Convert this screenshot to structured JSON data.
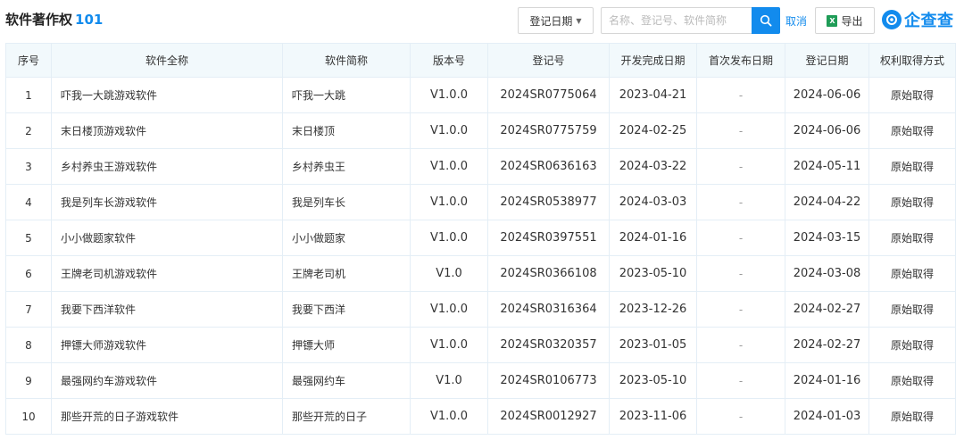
{
  "header": {
    "title": "软件著作权",
    "count": "101",
    "date_filter_label": "登记日期",
    "search_placeholder": "名称、登记号、软件简称",
    "cancel_label": "取消",
    "export_label": "导出",
    "logo_text": "企查查"
  },
  "colors": {
    "accent": "#128bed",
    "header_bg": "#f2f9fc",
    "border": "#e4eef6",
    "excel_green": "#1f9c57"
  },
  "icons": {
    "date_filter": "caret-down-icon",
    "search": "search-icon",
    "export": "excel-icon",
    "logo": "qcc-logo-icon"
  },
  "table": {
    "columns": [
      "序号",
      "软件全称",
      "软件简称",
      "版本号",
      "登记号",
      "开发完成日期",
      "首次发布日期",
      "登记日期",
      "权利取得方式"
    ],
    "rows": [
      [
        "1",
        "吓我一大跳游戏软件",
        "吓我一大跳",
        "V1.0.0",
        "2024SR0775064",
        "2023-04-21",
        "-",
        "2024-06-06",
        "原始取得"
      ],
      [
        "2",
        "末日楼顶游戏软件",
        "末日楼顶",
        "V1.0.0",
        "2024SR0775759",
        "2024-02-25",
        "-",
        "2024-06-06",
        "原始取得"
      ],
      [
        "3",
        "乡村养虫王游戏软件",
        "乡村养虫王",
        "V1.0.0",
        "2024SR0636163",
        "2024-03-22",
        "-",
        "2024-05-11",
        "原始取得"
      ],
      [
        "4",
        "我是列车长游戏软件",
        "我是列车长",
        "V1.0.0",
        "2024SR0538977",
        "2024-03-03",
        "-",
        "2024-04-22",
        "原始取得"
      ],
      [
        "5",
        "小小做题家软件",
        "小小做题家",
        "V1.0.0",
        "2024SR0397551",
        "2024-01-16",
        "-",
        "2024-03-15",
        "原始取得"
      ],
      [
        "6",
        "王牌老司机游戏软件",
        "王牌老司机",
        "V1.0",
        "2024SR0366108",
        "2023-05-10",
        "-",
        "2024-03-08",
        "原始取得"
      ],
      [
        "7",
        "我要下西洋软件",
        "我要下西洋",
        "V1.0.0",
        "2024SR0316364",
        "2023-12-26",
        "-",
        "2024-02-27",
        "原始取得"
      ],
      [
        "8",
        "押镖大师游戏软件",
        "押镖大师",
        "V1.0.0",
        "2024SR0320357",
        "2023-01-05",
        "-",
        "2024-02-27",
        "原始取得"
      ],
      [
        "9",
        "最强网约车游戏软件",
        "最强网约车",
        "V1.0",
        "2024SR0106773",
        "2023-05-10",
        "-",
        "2024-01-16",
        "原始取得"
      ],
      [
        "10",
        "那些开荒的日子游戏软件",
        "那些开荒的日子",
        "V1.0.0",
        "2024SR0012927",
        "2023-11-06",
        "-",
        "2024-01-03",
        "原始取得"
      ]
    ]
  }
}
